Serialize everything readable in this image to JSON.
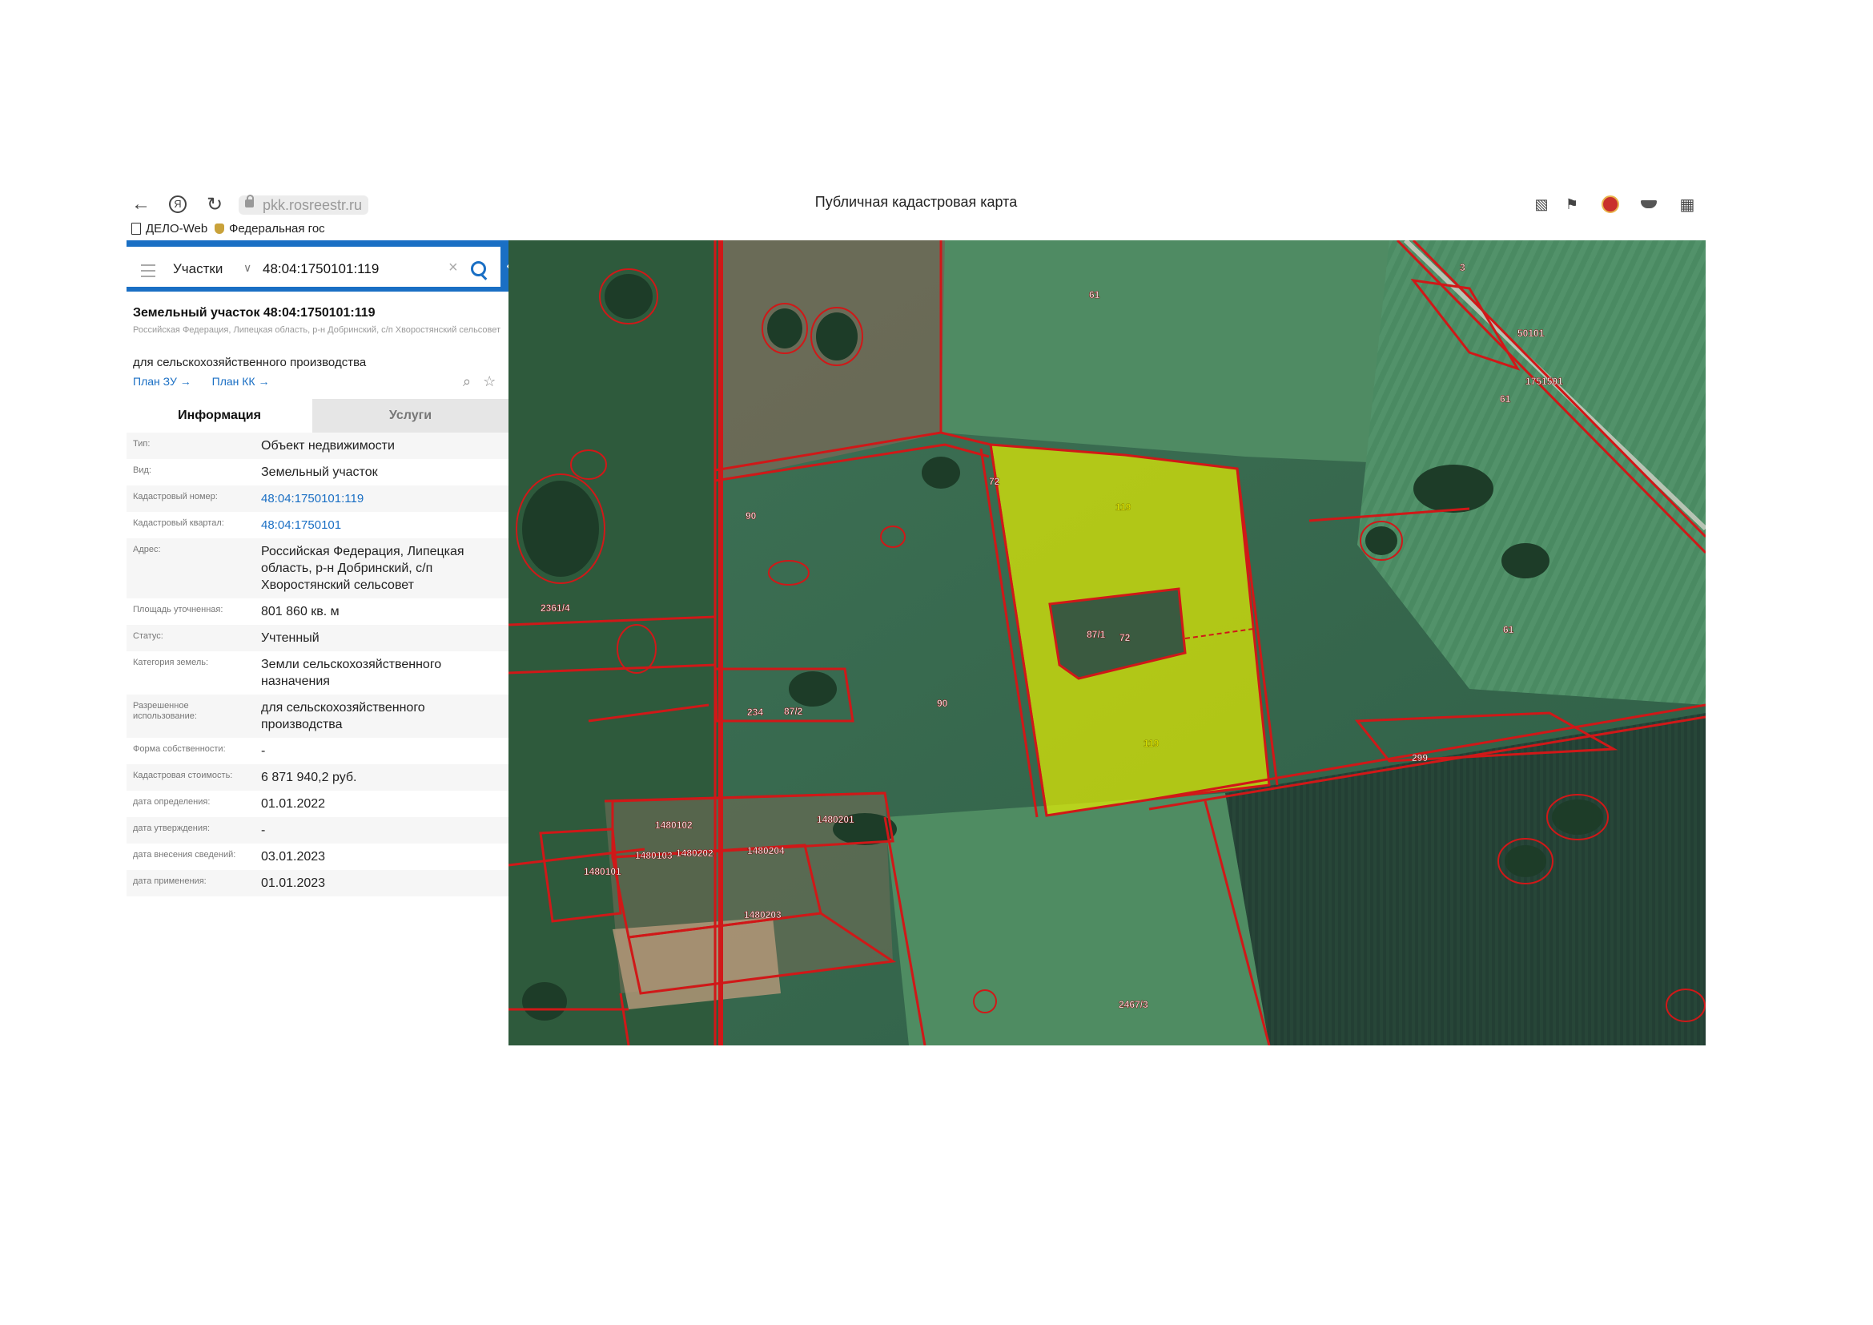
{
  "browser": {
    "url": "pkk.rosreestr.ru",
    "window_title": "Публичная кадастровая карта",
    "bookmarks": [
      {
        "label": "ДЕЛО-Web"
      },
      {
        "label": "Федеральная гос"
      }
    ]
  },
  "search": {
    "type": "Участки",
    "query": "48:04:1750101:119"
  },
  "object": {
    "title": "Земельный участок 48:04:1750101:119",
    "address_short": "Российская Федерация, Липецкая область, р-н Добринский, с/п Хворостянский сельсовет",
    "use": "для сельскохозяйственного производства",
    "link_plan_zu": "План ЗУ →",
    "link_plan_kk": "План КК →"
  },
  "tabs": [
    {
      "label": "Информация",
      "active": true
    },
    {
      "label": "Услуги",
      "active": false
    }
  ],
  "info_rows": [
    {
      "label": "Тип:",
      "value": "Объект недвижимости",
      "link": false
    },
    {
      "label": "Вид:",
      "value": "Земельный участок",
      "link": false
    },
    {
      "label": "Кадастровый номер:",
      "value": "48:04:1750101:119",
      "link": true
    },
    {
      "label": "Кадастровый квартал:",
      "value": "48:04:1750101",
      "link": true
    },
    {
      "label": "Адрес:",
      "value": "Российская Федерация, Липецкая область, р-н Добринский, с/п Хворостянский сельсовет",
      "link": false
    },
    {
      "label": "Площадь уточненная:",
      "value": "801 860 кв. м",
      "link": false
    },
    {
      "label": "Статус:",
      "value": "Учтенный",
      "link": false
    },
    {
      "label": "Категория земель:",
      "value": "Земли сельскохозяйственного назначения",
      "link": false
    },
    {
      "label": "Разрешенное использование:",
      "value": "для сельскохозяйственного производства",
      "link": false
    },
    {
      "label": "Форма собственности:",
      "value": "-",
      "link": false
    },
    {
      "label": "Кадастровая стоимость:",
      "value": "6 871 940,2 руб.",
      "link": false
    },
    {
      "label": "дата определения:",
      "value": "01.01.2022",
      "link": false
    },
    {
      "label": "дата утверждения:",
      "value": "-",
      "link": false
    },
    {
      "label": "дата внесения сведений:",
      "value": "03.01.2023",
      "link": false
    },
    {
      "label": "дата применения:",
      "value": "01.01.2023",
      "link": false
    }
  ],
  "map_labels": [
    "61",
    "3",
    "50101",
    "1751501",
    "61",
    "72",
    "119",
    "90",
    "2361/4",
    "87/1",
    "72",
    "61",
    "234",
    "87/2",
    "90",
    "119",
    "299",
    "1480102",
    "1480201",
    "1480103",
    "1480202",
    "1480204",
    "1480101",
    "1480203",
    "2467/3"
  ],
  "colors": {
    "accent": "#1a6fc4",
    "parcel_border": "#d01818",
    "selected_fill": "#e6f000"
  }
}
